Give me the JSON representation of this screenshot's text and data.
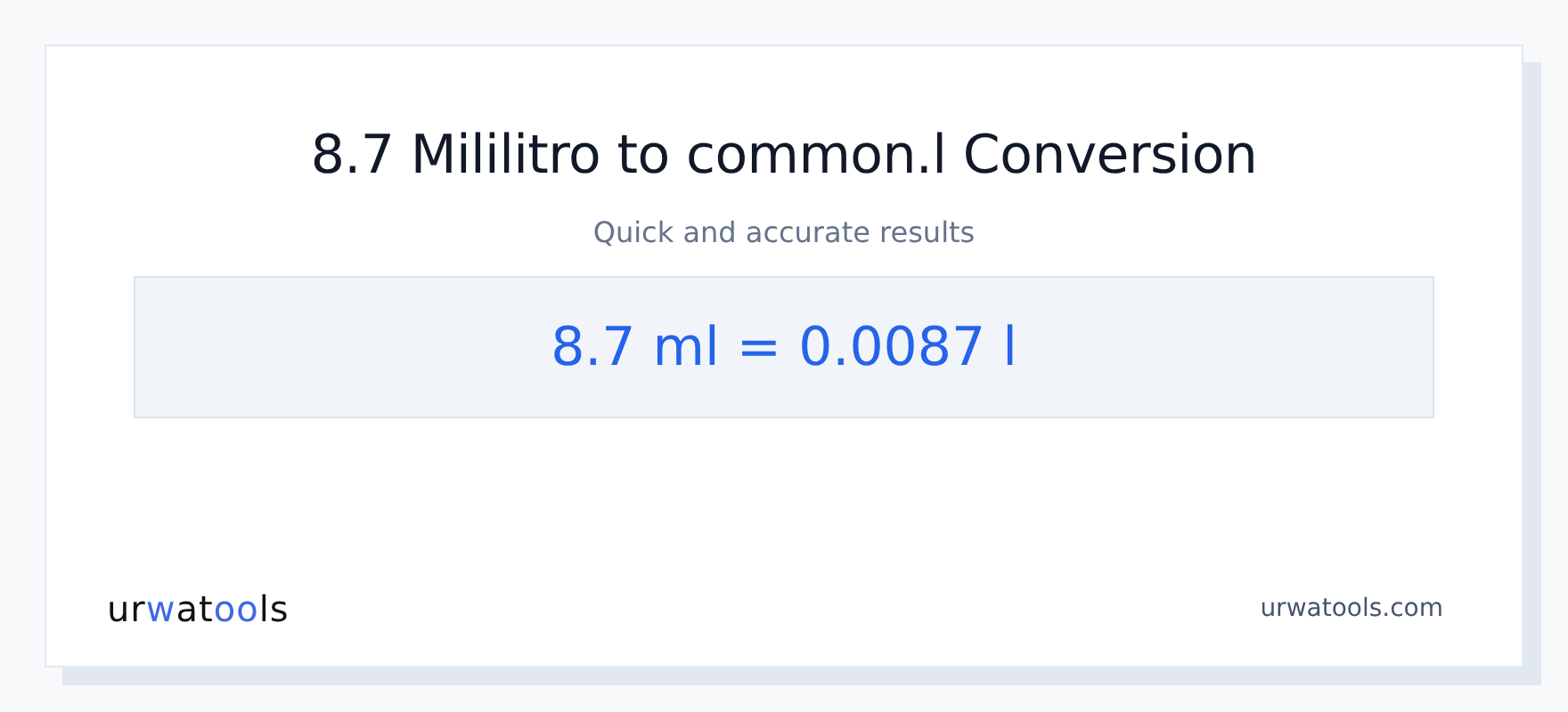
{
  "title": "8.7 Mililitro to common.l Conversion",
  "subtitle": "Quick and accurate results",
  "result": "8.7 ml = 0.0087 l",
  "logo": [
    {
      "text": "ur",
      "accent": false
    },
    {
      "text": "w",
      "accent": true
    },
    {
      "text": "at",
      "accent": false
    },
    {
      "text": "oo",
      "accent": true
    },
    {
      "text": "ls",
      "accent": false
    }
  ],
  "site": "urwatools.com"
}
